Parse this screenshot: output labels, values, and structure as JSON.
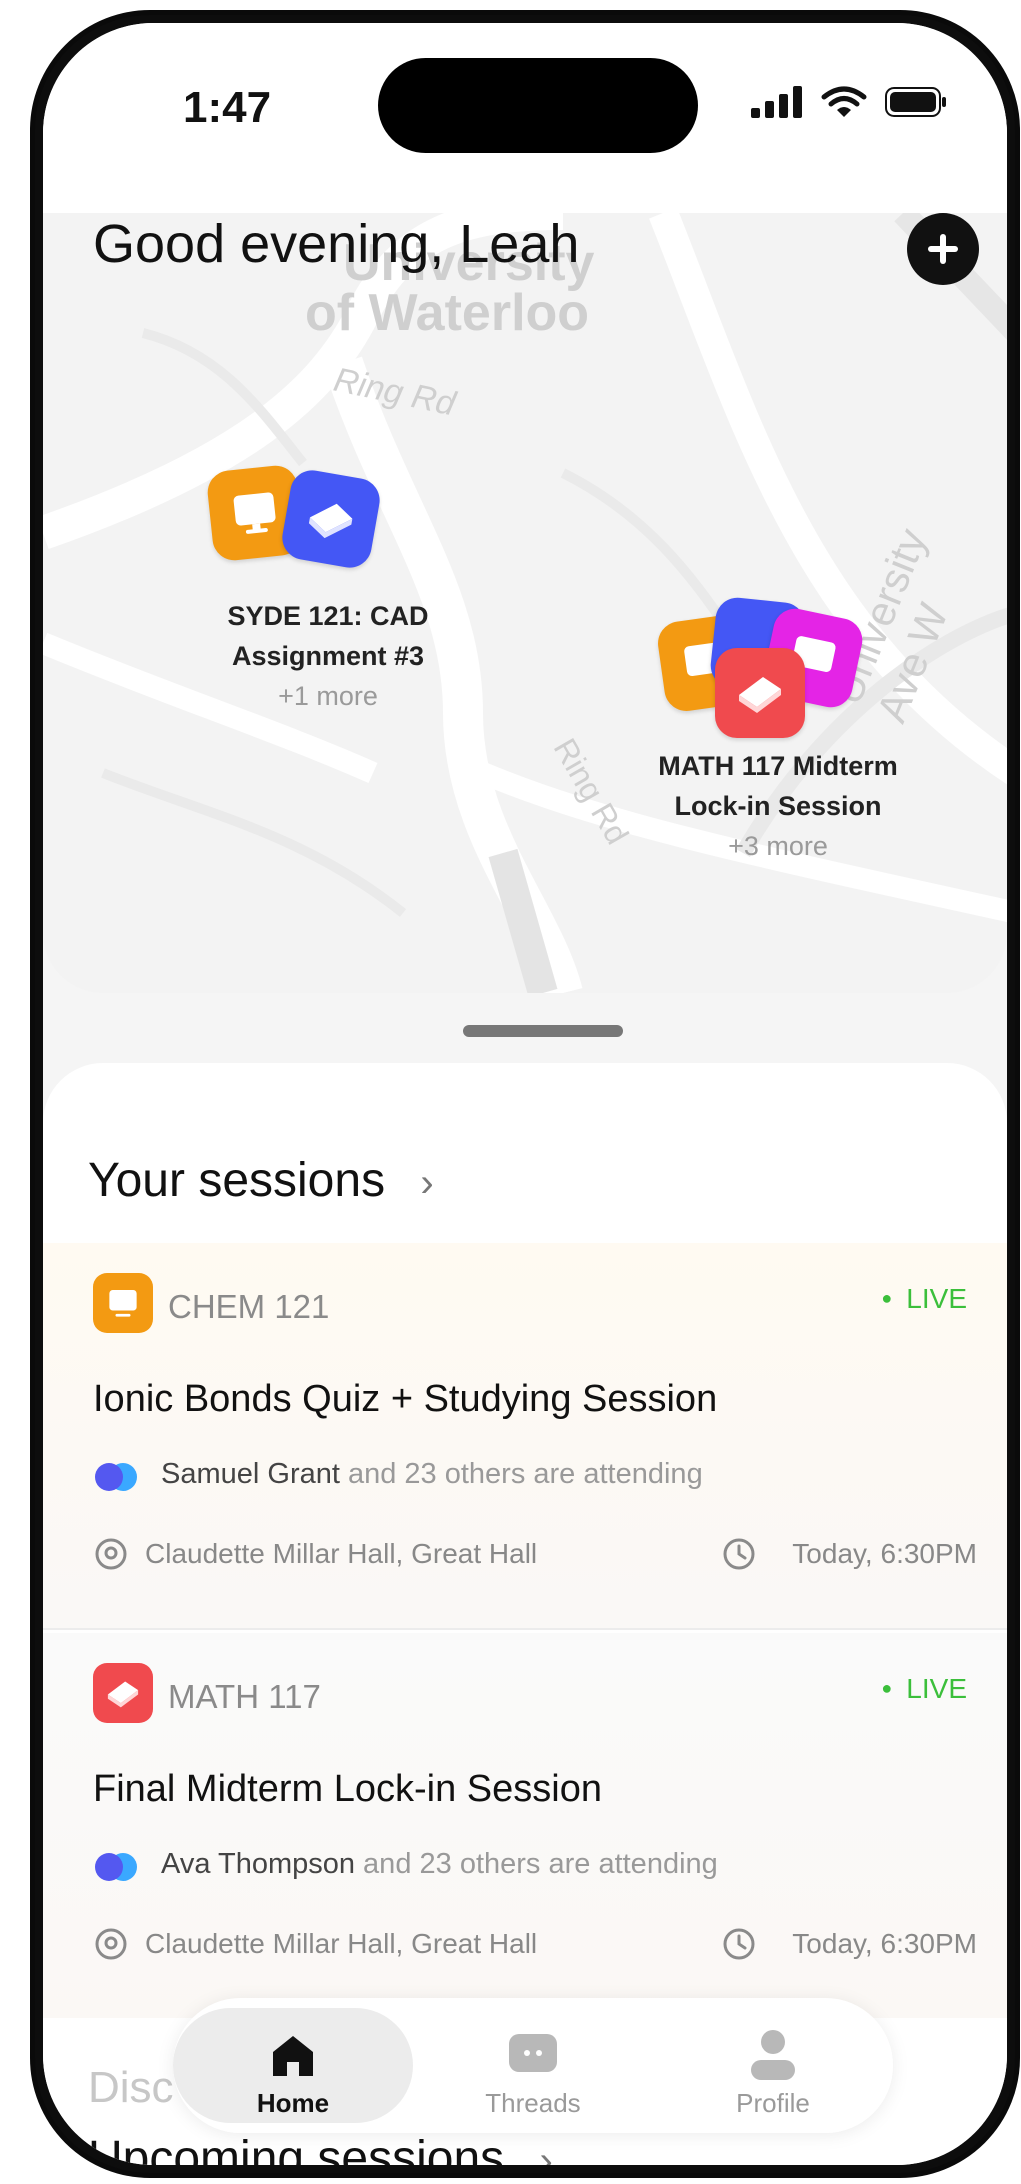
{
  "status_bar": {
    "time": "1:47"
  },
  "header": {
    "greeting": "Good evening, Leah"
  },
  "map": {
    "labels": {
      "campus_line1": "University",
      "campus_line2": "of Waterloo",
      "ring_rd_top": "Ring Rd",
      "ring_rd_mid": "Ring Rd",
      "university_ave": "University Ave W"
    },
    "clusters": [
      {
        "title_line1": "SYDE 121: CAD",
        "title_line2": "Assignment #3",
        "more": "+1 more"
      },
      {
        "title_line1": "MATH 117 Midterm",
        "title_line2": "Lock-in Session",
        "more": "+3 more"
      }
    ]
  },
  "sessions": {
    "section_title": "Your sessions",
    "items": [
      {
        "course": "CHEM 121",
        "status": "LIVE",
        "title": "Ionic Bonds Quiz + Studying Session",
        "host": "Samuel Grant",
        "attend_suffix": " and 23 others are attending",
        "location": "Claudette Millar Hall, Great Hall",
        "time": "Today, 6:30PM"
      },
      {
        "course": "MATH 117",
        "status": "LIVE",
        "title": "Final Midterm Lock-in Session",
        "host": "Ava Thompson",
        "attend_suffix": " and 23 others are attending",
        "location": "Claudette Millar Hall, Great Hall",
        "time": "Today, 6:30PM"
      }
    ]
  },
  "discover": {
    "partial_title": "Disc",
    "upcoming_title": "Upcoming sessions"
  },
  "tabs": [
    {
      "label": "Home"
    },
    {
      "label": "Threads"
    },
    {
      "label": "Profile"
    }
  ],
  "colors": {
    "orange": "#F39A12",
    "blue": "#4457F5",
    "magenta": "#E424E6",
    "red": "#F04A4E",
    "live_green": "#3BBF3B"
  },
  "icons": {
    "monitor": "monitor-icon",
    "book": "book-icon",
    "home": "home-icon",
    "chat": "chat-icon",
    "person": "person-icon",
    "location": "location-pin-icon",
    "clock": "clock-icon",
    "plus": "plus-icon"
  }
}
